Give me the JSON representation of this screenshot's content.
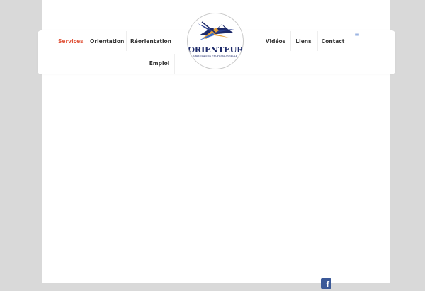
{
  "nav": {
    "items": [
      {
        "label": "Services",
        "active": true
      },
      {
        "label": "Orientation",
        "active": false
      },
      {
        "label": "Réorientation",
        "active": false
      },
      {
        "label": "Vidéos",
        "active": false
      },
      {
        "label": "Liens",
        "active": false
      },
      {
        "label": "Contact",
        "active": false
      },
      {
        "label": "Emploi",
        "active": false
      }
    ],
    "menu_icon": "hamburger-menu-icon"
  },
  "logo": {
    "title": "ORIENTEUR",
    "subtitle": "ORIENTATION PROFESSIONNELLE"
  },
  "footer": {
    "social_icon": "facebook-icon"
  },
  "colors": {
    "active": "#e0543a",
    "nav_text": "#333333",
    "logo_navy": "#1d2a6a",
    "accent_blue": "#3a6bc4",
    "facebook": "#3b5998",
    "background": "#d9d9d9"
  }
}
